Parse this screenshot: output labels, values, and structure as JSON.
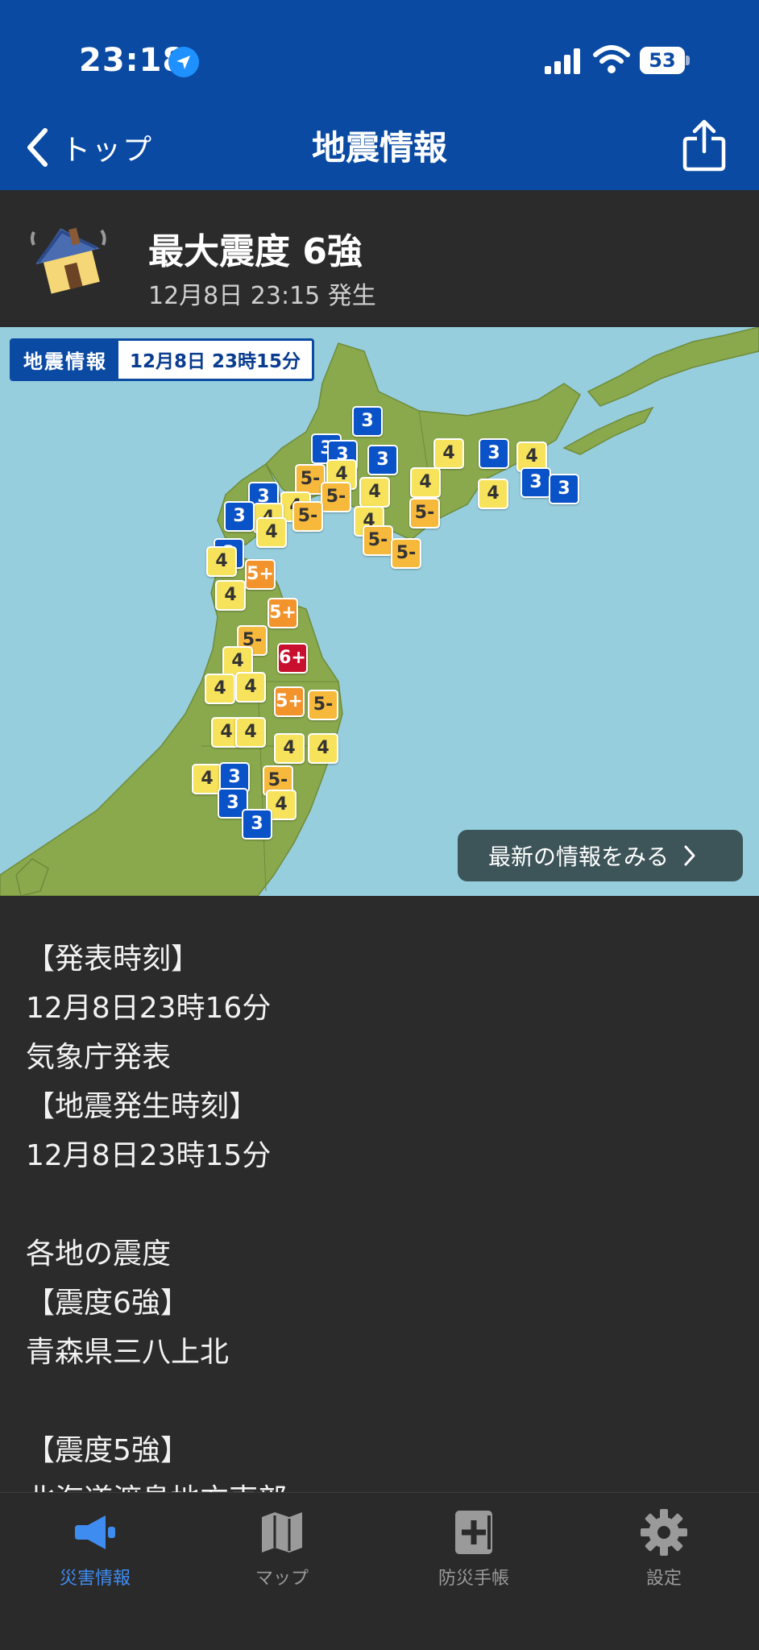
{
  "status_bar": {
    "time": "23:18",
    "battery": "53"
  },
  "nav": {
    "back_label": "トップ",
    "title": "地震情報"
  },
  "summary": {
    "max_intensity": "最大震度 6強",
    "occurred": "12月8日 23:15 発生"
  },
  "map": {
    "tag_label": "地震情報",
    "tag_time": "12月8日 23時15分",
    "latest_button": "最新の情報をみる",
    "markers": [
      {
        "value": "3"
      },
      {
        "value": "3"
      },
      {
        "value": "3"
      },
      {
        "value": "3"
      },
      {
        "value": "4"
      },
      {
        "value": "3"
      },
      {
        "value": "4"
      },
      {
        "value": "3"
      },
      {
        "value": "3"
      },
      {
        "value": "5-"
      },
      {
        "value": "4"
      },
      {
        "value": "5-"
      },
      {
        "value": "4"
      },
      {
        "value": "4"
      },
      {
        "value": "4"
      },
      {
        "value": "3"
      },
      {
        "value": "4"
      },
      {
        "value": "4"
      },
      {
        "value": "5-"
      },
      {
        "value": "5-"
      },
      {
        "value": "4"
      },
      {
        "value": "3"
      },
      {
        "value": "4"
      },
      {
        "value": "5-"
      },
      {
        "value": "5-"
      },
      {
        "value": "3"
      },
      {
        "value": "4"
      },
      {
        "value": "5+"
      },
      {
        "value": "4"
      },
      {
        "value": "5+"
      },
      {
        "value": "5-"
      },
      {
        "value": "4"
      },
      {
        "value": "6+"
      },
      {
        "value": "4"
      },
      {
        "value": "4"
      },
      {
        "value": "5+"
      },
      {
        "value": "5-"
      },
      {
        "value": "4"
      },
      {
        "value": "4"
      },
      {
        "value": "4"
      },
      {
        "value": "4"
      },
      {
        "value": "4"
      },
      {
        "value": "3"
      },
      {
        "value": "5-"
      },
      {
        "value": "3"
      },
      {
        "value": "4"
      },
      {
        "value": "3"
      }
    ]
  },
  "content_lines": [
    "【発表時刻】",
    "12月8日23時16分",
    "気象庁発表",
    "【地震発生時刻】",
    "12月8日23時15分",
    "",
    "各地の震度",
    "【震度6強】",
    "青森県三八上北",
    "",
    "【震度5強】",
    "北海道渡島地方東部"
  ],
  "tabs": [
    {
      "label": "災害情報",
      "icon": "megaphone-icon",
      "active": true
    },
    {
      "label": "マップ",
      "icon": "map-icon",
      "active": false
    },
    {
      "label": "防災手帳",
      "icon": "handbook-icon",
      "active": false
    },
    {
      "label": "設定",
      "icon": "gear-icon",
      "active": false
    }
  ],
  "colors": {
    "header": "#0a4aa3",
    "background": "#2b2b2b",
    "sea": "#96cede",
    "land": "#8aa94d",
    "intensity_3": "#0a52c8",
    "intensity_4": "#f7e25b",
    "intensity_5_minus": "#f7b93c",
    "intensity_5_plus": "#f2932c",
    "intensity_6_plus": "#c8102e",
    "active_tab": "#3f8cf0"
  }
}
